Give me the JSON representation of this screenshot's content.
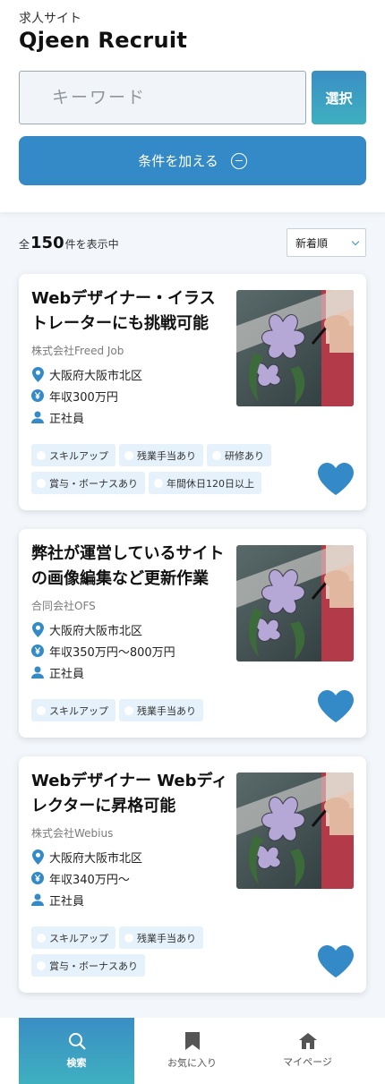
{
  "header": {
    "subtitle": "求人サイト",
    "title": "Qjeen Recruit",
    "search_placeholder": "キーワード",
    "select_label": "選択",
    "conditions_label": "条件を加える"
  },
  "results": {
    "prefix": "全",
    "count": "150",
    "suffix": "件を表示中",
    "sort_selected": "新着順"
  },
  "jobs": [
    {
      "title": "Webデザイナー・イラストレーターにも挑戦可能",
      "company": "株式会社Freed Job",
      "location": "大阪府大阪市北区",
      "salary": "年収300万円",
      "employment": "正社員",
      "tags": [
        "スキルアップ",
        "残業手当あり",
        "研修あり",
        "賞与・ボーナスあり",
        "年間休日120日以上"
      ]
    },
    {
      "title": "弊社が運営しているサイトの画像編集など更新作業",
      "company": "合同会社OFS",
      "location": "大阪府大阪市北区",
      "salary": "年収350万円〜800万円",
      "employment": "正社員",
      "tags": [
        "スキルアップ",
        "残業手当あり"
      ]
    },
    {
      "title": "Webデザイナー Webディレクターに昇格可能",
      "company": "株式会社Webius",
      "location": "大阪府大阪市北区",
      "salary": "年収340万円〜",
      "employment": "正社員",
      "tags": [
        "スキルアップ",
        "残業手当あり",
        "賞与・ボーナスあり"
      ]
    }
  ],
  "nav": {
    "search": "検索",
    "favorites": "お気に入り",
    "mypage": "マイページ"
  },
  "colors": {
    "primary": "#348ac6",
    "gradient_end": "#3fb0c0",
    "tag_bg": "#e5f2fb"
  }
}
